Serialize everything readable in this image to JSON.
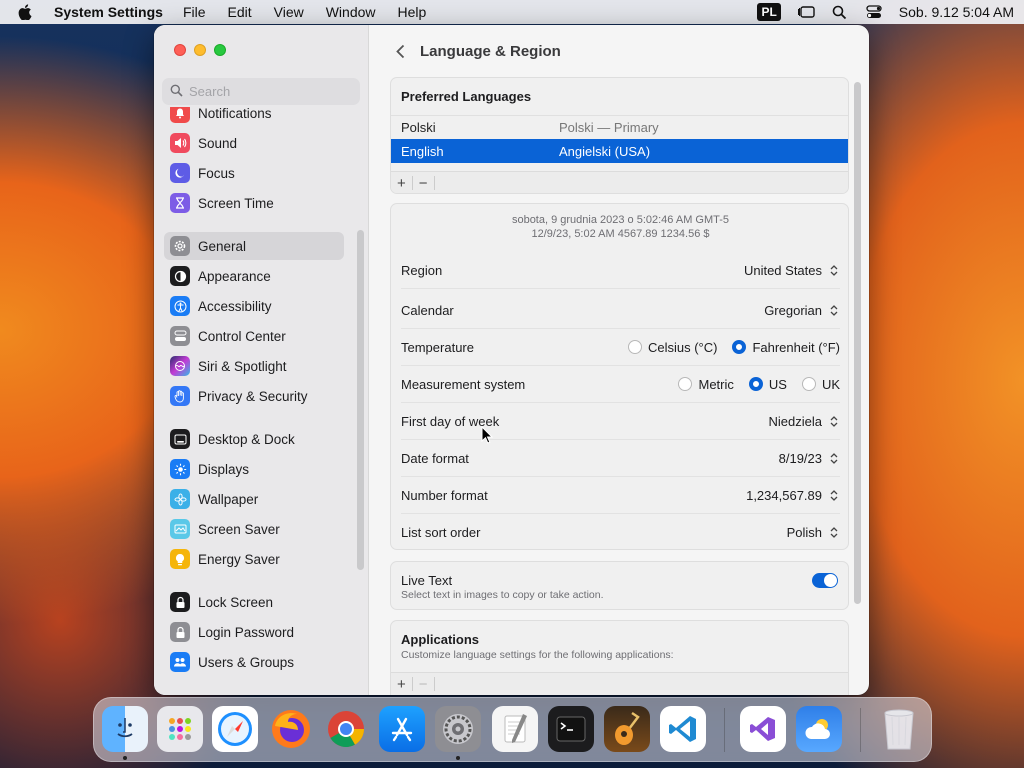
{
  "menubar": {
    "app_name": "System Settings",
    "items": [
      "File",
      "Edit",
      "View",
      "Window",
      "Help"
    ],
    "input_source": "PL",
    "clock": "Sob. 9.12  5:04 AM"
  },
  "sidebar": {
    "search_placeholder": "Search",
    "items": [
      {
        "label": "Notifications",
        "icon": "bell-icon",
        "color": "#f04a4a"
      },
      {
        "label": "Sound",
        "icon": "speaker-icon",
        "color": "#f04a5e"
      },
      {
        "label": "Focus",
        "icon": "moon-icon",
        "color": "#5e5ce6"
      },
      {
        "label": "Screen Time",
        "icon": "hourglass-icon",
        "color": "#7d5ce6"
      },
      {
        "label": "General",
        "icon": "gear-icon",
        "color": "#8e8e93"
      },
      {
        "label": "Appearance",
        "icon": "appearance-icon",
        "color": "#1c1c1e"
      },
      {
        "label": "Accessibility",
        "icon": "accessibility-icon",
        "color": "#1a7cf5"
      },
      {
        "label": "Control Center",
        "icon": "control-center-icon",
        "color": "#8e8e93"
      },
      {
        "label": "Siri & Spotlight",
        "icon": "siri-icon",
        "color": "#2d2d6e"
      },
      {
        "label": "Privacy & Security",
        "icon": "hand-icon",
        "color": "#3478f6"
      },
      {
        "label": "Desktop & Dock",
        "icon": "dock-icon",
        "color": "#1c1c1e"
      },
      {
        "label": "Displays",
        "icon": "sun-icon",
        "color": "#1a7cf5"
      },
      {
        "label": "Wallpaper",
        "icon": "flower-icon",
        "color": "#3bb0e8"
      },
      {
        "label": "Screen Saver",
        "icon": "screen-saver-icon",
        "color": "#5ac8e8"
      },
      {
        "label": "Energy Saver",
        "icon": "bulb-icon",
        "color": "#f5b50a"
      },
      {
        "label": "Lock Screen",
        "icon": "lock-icon",
        "color": "#1c1c1e"
      },
      {
        "label": "Login Password",
        "icon": "lock-small-icon",
        "color": "#8e8e93"
      },
      {
        "label": "Users & Groups",
        "icon": "users-icon",
        "color": "#1a7cf5"
      }
    ],
    "selected": "General"
  },
  "main": {
    "title": "Language & Region",
    "preferred_languages": {
      "header": "Preferred Languages",
      "rows": [
        {
          "name": "Polski",
          "detail": "Polski — Primary"
        },
        {
          "name": "English",
          "detail": "Angielski (USA)"
        }
      ],
      "add_label": "+",
      "remove_label": "−"
    },
    "sample": {
      "line1": "sobota, 9 grudnia 2023 o 5:02:46 AM GMT-5",
      "line2": "12/9/23, 5:02 AM     4567.89     1234.56 $"
    },
    "settings": {
      "region": {
        "label": "Region",
        "value": "United States"
      },
      "calendar": {
        "label": "Calendar",
        "value": "Gregorian"
      },
      "temperature": {
        "label": "Temperature",
        "options": [
          "Celsius (°C)",
          "Fahrenheit (°F)"
        ],
        "selected": "Fahrenheit (°F)"
      },
      "measurement": {
        "label": "Measurement system",
        "options": [
          "Metric",
          "US",
          "UK"
        ],
        "selected": "US"
      },
      "first_day": {
        "label": "First day of week",
        "value": "Niedziela"
      },
      "date_format": {
        "label": "Date format",
        "value": "8/19/23"
      },
      "number_format": {
        "label": "Number format",
        "value": "1,234,567.89"
      },
      "sort_order": {
        "label": "List sort order",
        "value": "Polish"
      }
    },
    "live_text": {
      "label": "Live Text",
      "description": "Select text in images to copy or take action.",
      "enabled": true
    },
    "applications": {
      "header": "Applications",
      "description": "Customize language settings for the following applications:",
      "add_label": "+",
      "remove_label": "−"
    }
  },
  "dock": {
    "apps": [
      "finder-icon",
      "launchpad-icon",
      "safari-icon",
      "firefox-icon",
      "chrome-icon",
      "app-store-icon",
      "system-settings-icon",
      "script-editor-icon",
      "terminal-icon",
      "garageband-icon",
      "vscode-icon",
      "visual-studio-icon",
      "weather-icon",
      "trash-icon"
    ]
  }
}
